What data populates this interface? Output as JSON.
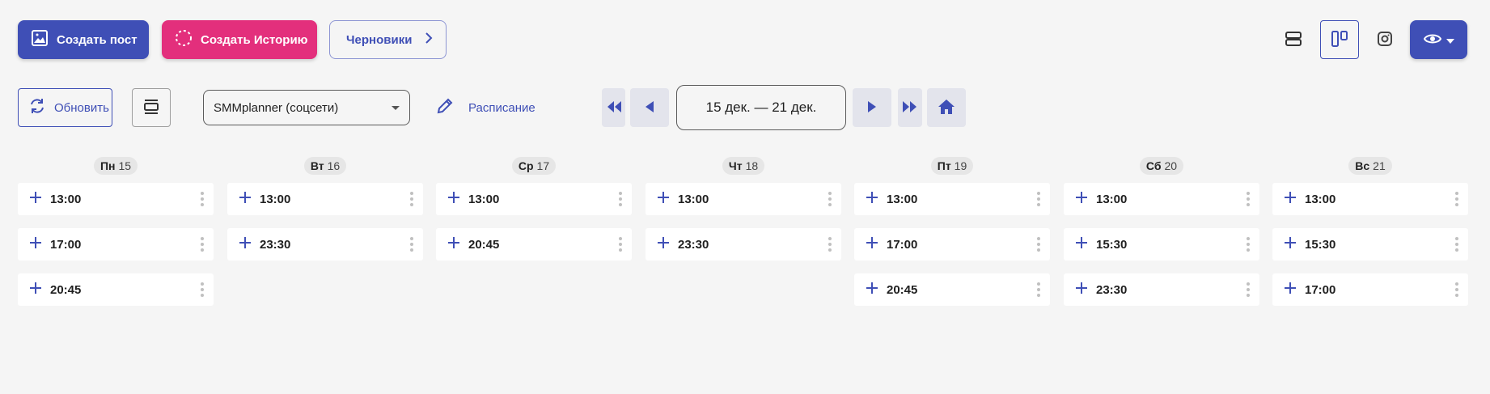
{
  "toolbar": {
    "create_post": "Создать пост",
    "create_story": "Создать Историю",
    "drafts": "Черновики",
    "refresh": "Обновить",
    "account": "SMMplanner (соцсети)",
    "schedule": "Расписание",
    "week_range": "15 дек. — 21 дек."
  },
  "colors": {
    "primary": "#3f4fb6",
    "story": "#e32f7c",
    "background": "#f5f5f5"
  },
  "days": [
    {
      "weekday": "Пн",
      "date": "15",
      "slots": [
        "13:00",
        "17:00",
        "20:45"
      ]
    },
    {
      "weekday": "Вт",
      "date": "16",
      "slots": [
        "13:00",
        "23:30"
      ]
    },
    {
      "weekday": "Ср",
      "date": "17",
      "slots": [
        "13:00",
        "20:45"
      ]
    },
    {
      "weekday": "Чт",
      "date": "18",
      "slots": [
        "13:00",
        "23:30"
      ]
    },
    {
      "weekday": "Пт",
      "date": "19",
      "slots": [
        "13:00",
        "17:00",
        "20:45"
      ]
    },
    {
      "weekday": "Сб",
      "date": "20",
      "slots": [
        "13:00",
        "15:30",
        "23:30"
      ]
    },
    {
      "weekday": "Вс",
      "date": "21",
      "slots": [
        "13:00",
        "15:30",
        "17:00"
      ]
    }
  ]
}
